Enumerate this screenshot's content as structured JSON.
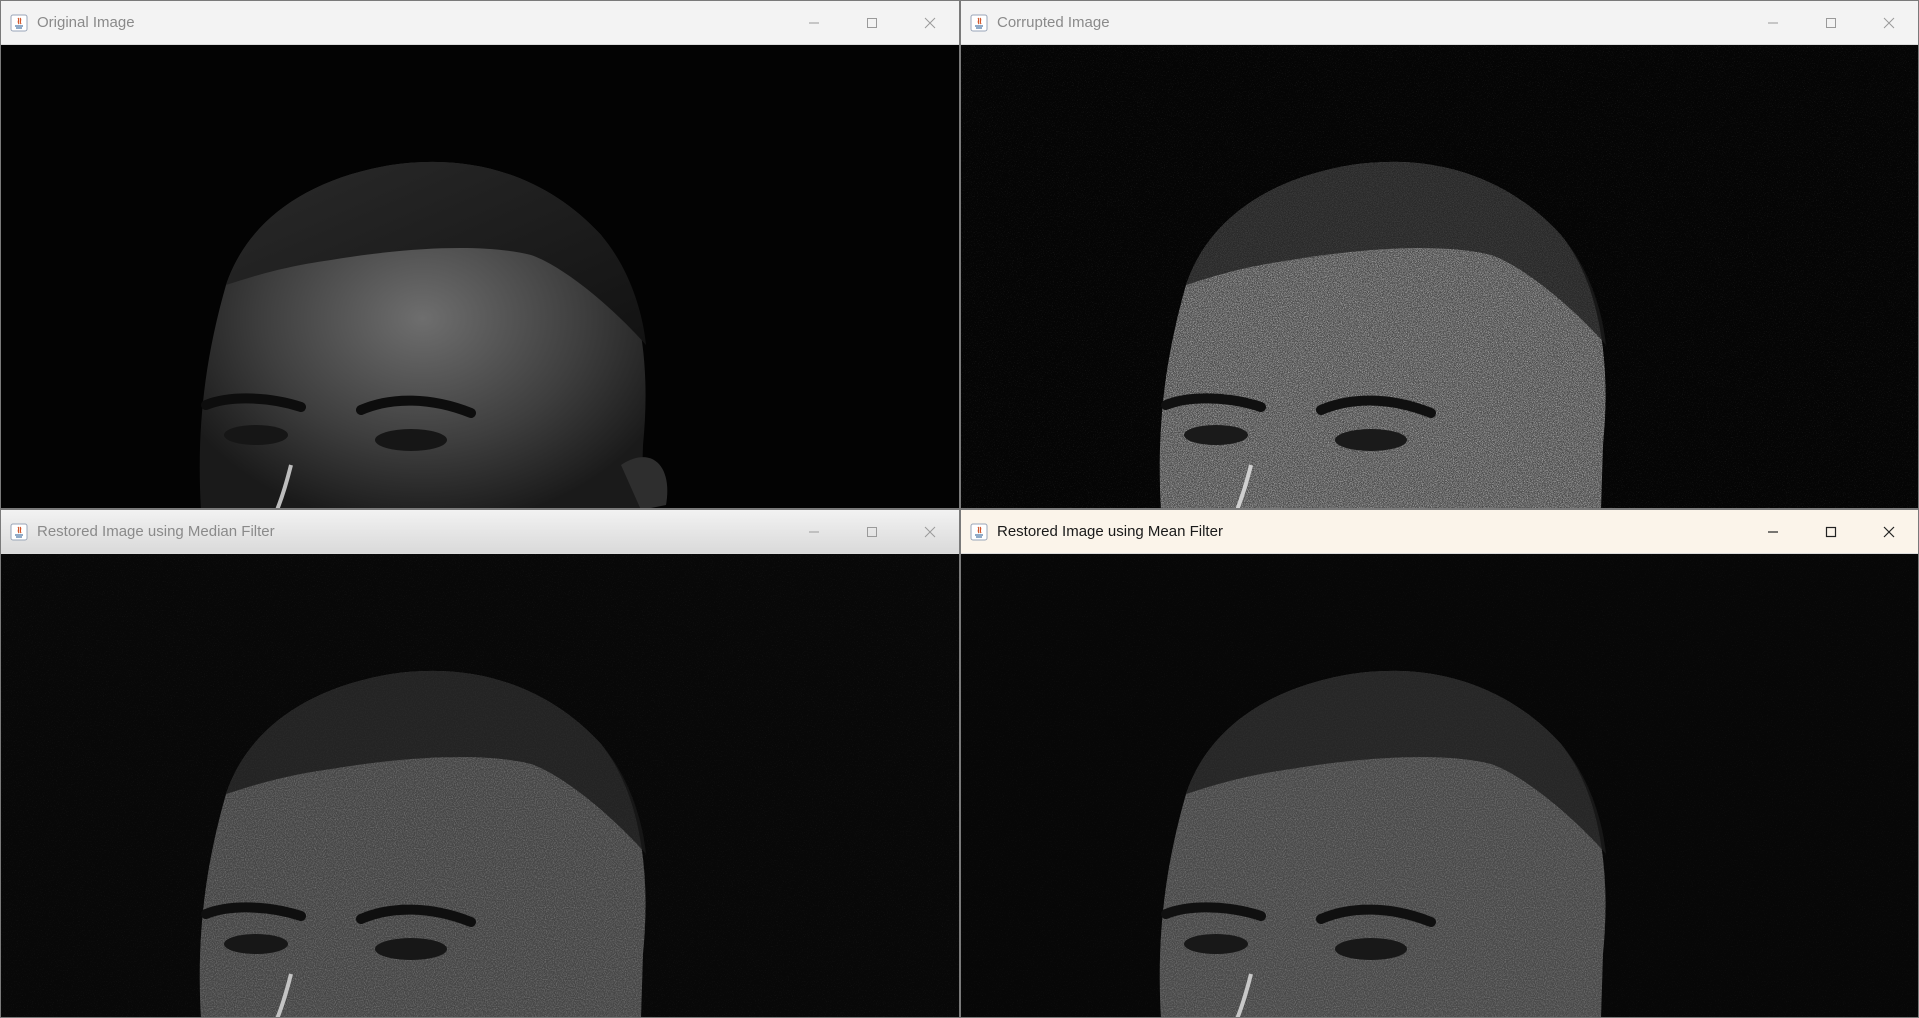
{
  "windows": {
    "original": {
      "title": "Original Image"
    },
    "corrupted": {
      "title": "Corrupted Image"
    },
    "median": {
      "title": "Restored Image using Median Filter"
    },
    "mean": {
      "title": "Restored Image using Mean Filter"
    }
  },
  "icons": {
    "app": "java-app-icon",
    "minimize": "minimize-icon",
    "maximize": "maximize-icon",
    "close": "close-icon"
  },
  "colors": {
    "titlebar_inactive": "#f3f3f3",
    "titlebar_active": "#fbf4ea",
    "title_inactive_text": "#8a8a8a",
    "title_active_text": "#1a1a1a",
    "image_background": "#020202"
  }
}
